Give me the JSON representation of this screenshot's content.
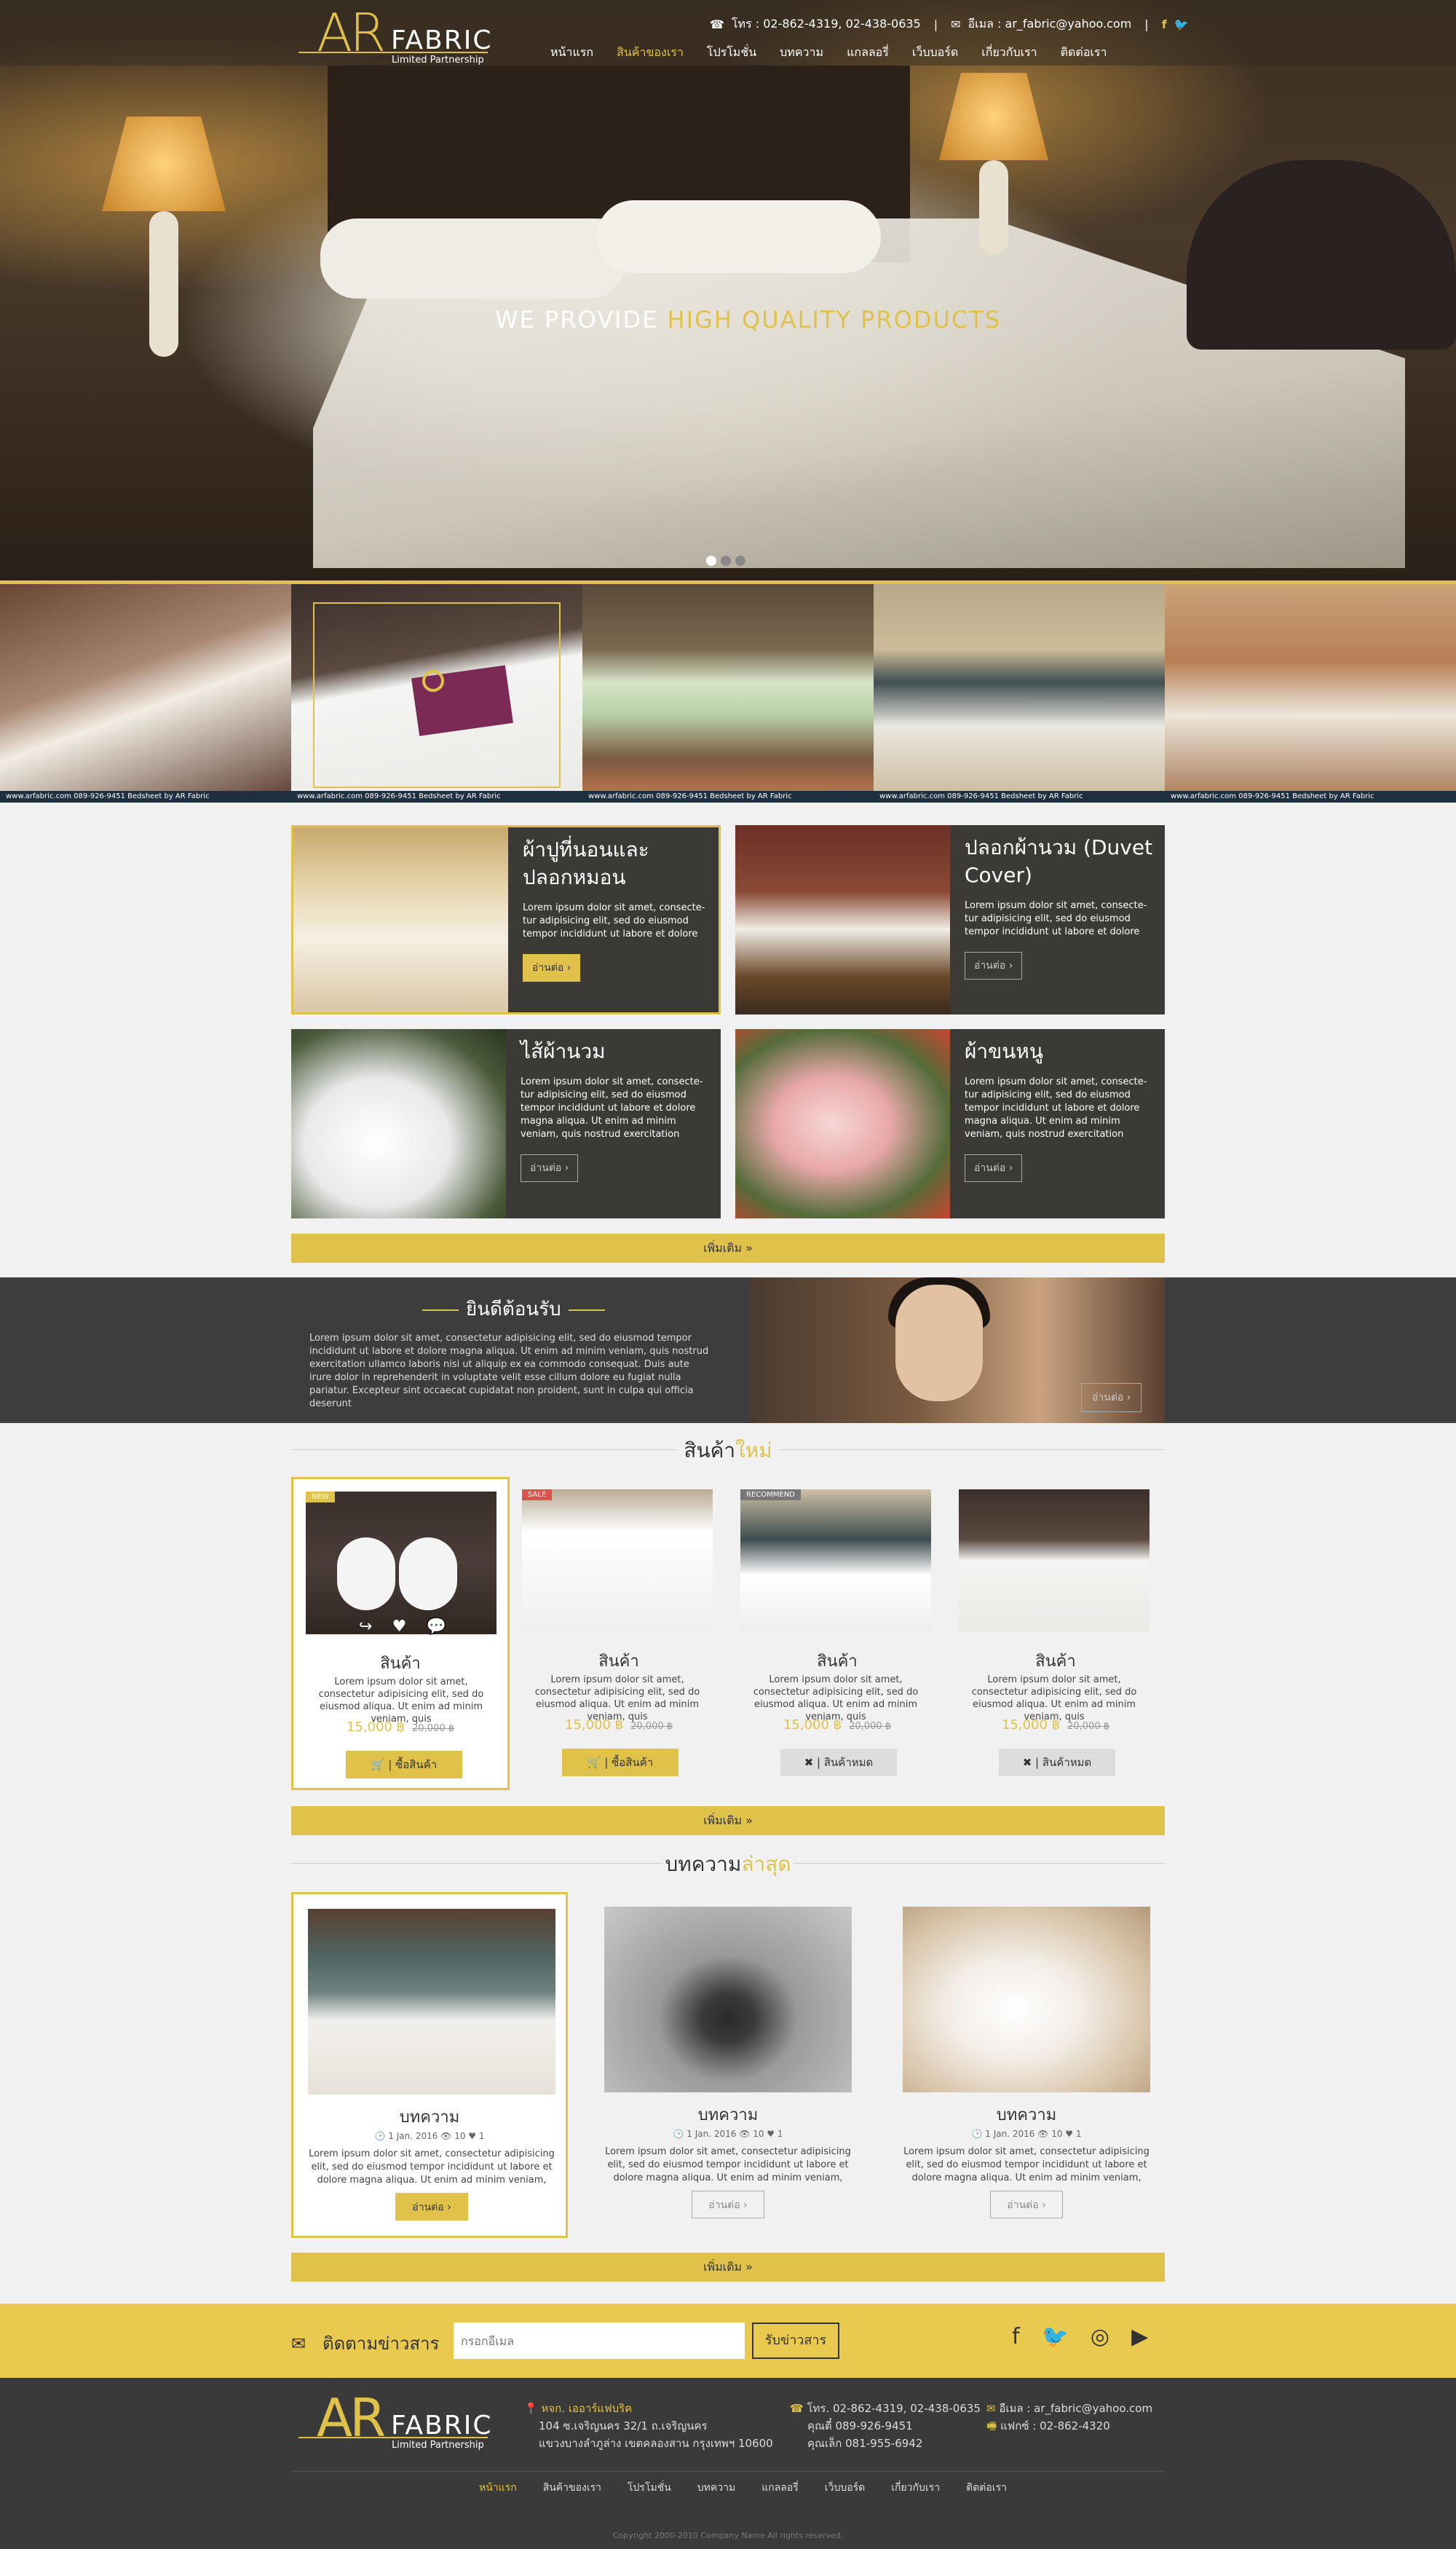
{
  "brand": {
    "ar": "AR",
    "fabric": "FABRIC",
    "tagline": "Limited Partnership"
  },
  "topbar": {
    "phone_icon": "phone-icon",
    "phone": "โทร : 02-862-4319, 02-438-0635",
    "email_icon": "envelope-icon",
    "email": "อีเมล : ar_fabric@yahoo.com",
    "social": [
      "f",
      "twitter"
    ]
  },
  "nav": [
    "หน้าแรก",
    "สินค้าของเรา",
    "โปรโมชั่น",
    "บทความ",
    "แกลลอรี่",
    "เว็บบอร์ด",
    "เกี่ยวกับเรา",
    "ติดต่อเรา"
  ],
  "nav_active": 1,
  "hero": {
    "text_white": "WE PROVIDE",
    "text_gold": "HIGH QUALITY PRODUCTS",
    "dots": 3,
    "active_dot": 0
  },
  "strip_caption": "www.arfabric.com   089-926-9451   Bedsheet by AR Fabric",
  "categories": [
    {
      "title": "ผ้าปูที่นอนและปลอกหมอน",
      "desc": "Lorem ipsum dolor sit amet, consecte-tur adipisicing elit, sed do eiusmod tempor incididunt ut labore et dolore",
      "btn": "อ่านต่อ ›"
    },
    {
      "title": "ปลอกผ้านวม (Duvet Cover)",
      "desc": "Lorem ipsum dolor sit amet, consecte-tur adipisicing elit, sed do eiusmod tempor incididunt ut labore et dolore",
      "btn": "อ่านต่อ ›"
    },
    {
      "title": "ไส้ผ้านวม",
      "desc": "Lorem ipsum dolor sit amet, consecte-tur adipisicing elit, sed do eiusmod tempor incididunt ut labore et dolore magna aliqua. Ut enim ad minim veniam, quis nostrud exercitation",
      "btn": "อ่านต่อ ›"
    },
    {
      "title": "ผ้าขนหนู",
      "desc": "Lorem ipsum dolor sit amet, consecte-tur adipisicing elit, sed do eiusmod tempor incididunt ut labore et dolore magna aliqua. Ut enim ad minim veniam, quis nostrud exercitation",
      "btn": "อ่านต่อ ›"
    }
  ],
  "more_label": "เพิ่มเติม »",
  "welcome": {
    "title": "ยินดีต้อนรับ",
    "text": "Lorem ipsum dolor sit amet, consectetur adipisicing elit, sed do eiusmod tempor incididunt ut labore et dolore magna aliqua. Ut enim ad minim veniam, quis nostrud exercitation ullamco laboris nisi ut aliquip ex ea commodo consequat. Duis aute irure dolor in reprehenderit in voluptate velit esse cillum dolore eu fugiat nulla pariatur. Excepteur sint occaecat cupidatat non proident, sunt in culpa qui officia deserunt",
    "btn": "อ่านต่อ ›"
  },
  "products_head": {
    "a": "สินค้า",
    "b": "ใหม่"
  },
  "products": [
    {
      "badge": "NEW",
      "badge_color": "#e0c24a",
      "name": "สินค้า",
      "desc": "Lorem ipsum dolor sit amet, consectetur adipisicing elit, sed do eiusmod aliqua. Ut enim ad minim veniam, quis",
      "price": "15,000 ฿",
      "old": "20,000 ฿",
      "btn": "🛒 | ซื้อสินค้า",
      "kind": "buy"
    },
    {
      "badge": "SALE",
      "badge_color": "#d9534f",
      "name": "สินค้า",
      "desc": "Lorem ipsum dolor sit amet, consectetur adipisicing elit, sed do eiusmod aliqua. Ut enim ad minim veniam, quis",
      "price": "15,000 ฿",
      "old": "20,000 ฿",
      "btn": "🛒 | ซื้อสินค้า",
      "kind": "buy"
    },
    {
      "badge": "RECOMMEND",
      "badge_color": "#777777",
      "name": "สินค้า",
      "desc": "Lorem ipsum dolor sit amet, consectetur adipisicing elit, sed do eiusmod aliqua. Ut enim ad minim veniam, quis",
      "price": "15,000 ฿",
      "old": "20,000 ฿",
      "btn": "✖ | สินค้าหมด",
      "kind": "out"
    },
    {
      "badge": "",
      "badge_color": "",
      "name": "สินค้า",
      "desc": "Lorem ipsum dolor sit amet, consectetur adipisicing elit, sed do eiusmod aliqua. Ut enim ad minim veniam, quis",
      "price": "15,000 ฿",
      "old": "20,000 ฿",
      "btn": "✖ | สินค้าหมด",
      "kind": "out"
    }
  ],
  "articles_head": {
    "a": "บทความ",
    "b": "ล่าสุด"
  },
  "articles": [
    {
      "name": "บทความ",
      "meta": "🕒 1 Jan. 2016  👁 10  ♥ 1",
      "desc": "Lorem ipsum dolor sit amet, consectetur adipisicing elit, sed do eiusmod tempor incididunt ut labore et dolore magna aliqua. Ut enim ad minim veniam,",
      "btn": "อ่านต่อ ›"
    },
    {
      "name": "บทความ",
      "meta": "🕒 1 Jan. 2016  👁 10  ♥ 1",
      "desc": "Lorem ipsum dolor sit amet, consectetur adipisicing elit, sed do eiusmod tempor incididunt ut labore et dolore magna aliqua. Ut enim ad minim veniam,",
      "btn": "อ่านต่อ ›"
    },
    {
      "name": "บทความ",
      "meta": "🕒 1 Jan. 2016  👁 10  ♥ 1",
      "desc": "Lorem ipsum dolor sit amet, consectetur adipisicing elit, sed do eiusmod tempor incididunt ut labore et dolore magna aliqua. Ut enim ad minim veniam,",
      "btn": "อ่านต่อ ›"
    }
  ],
  "newsletter": {
    "label": "ติดตามข่าวสาร",
    "placeholder": "กรอกอีเมล",
    "submit": "รับข่าวสาร",
    "icons": [
      "facebook-icon",
      "twitter-icon",
      "instagram-icon",
      "youtube-icon"
    ]
  },
  "footer": {
    "company": "หจก. เออาร์แฟบริค",
    "address1": "104 ซ.เจริญนคร 32/1 ถ.เจริญนคร",
    "address2": "แขวงบางลำภูล่าง เขตคลองสาน กรุงเทพฯ 10600",
    "phone": "โทร. 02-862-4319, 02-438-0635",
    "mobile1": "คุณตี๋ 089-926-9451",
    "mobile2": "คุณเล็ก 081-955-6942",
    "email": "อีเมล : ar_fabric@yahoo.com",
    "fax": "แฟกซ์ : 02-862-4320",
    "copyright": "Copyright 2000-2010 Company Name All rights reserved."
  },
  "colors": {
    "accent": "#e0c24a",
    "dark": "#3a3a3a"
  }
}
